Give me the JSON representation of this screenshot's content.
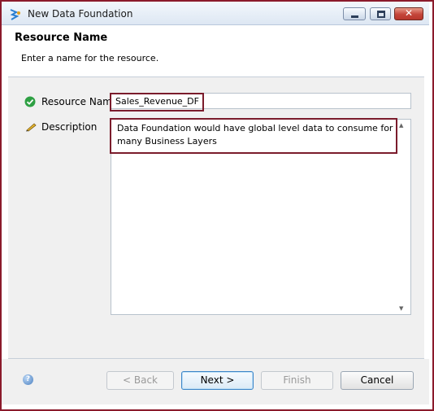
{
  "window": {
    "title": "New Data Foundation"
  },
  "header": {
    "title": "Resource Name",
    "subtitle": "Enter a name for the resource."
  },
  "form": {
    "resource_name_label": "Resource Name",
    "resource_name_value": "Sales_Revenue_DF",
    "description_label": "Description",
    "description_line1": "Data Foundation would have global level data to consume for",
    "description_line2": "many Business Layers"
  },
  "buttons": {
    "back": "< Back",
    "next": "Next >",
    "finish": "Finish",
    "cancel": "Cancel"
  },
  "icons": {
    "app": "sap-bo-icon",
    "name_status": "check-circle-icon",
    "description": "pencil-icon",
    "help": "help-icon"
  }
}
